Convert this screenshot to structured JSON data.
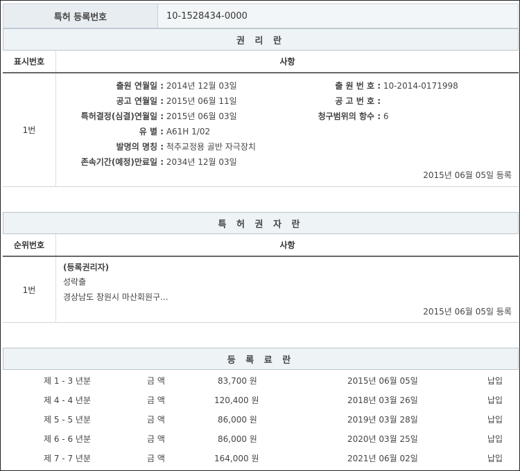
{
  "top": {
    "label": "특허 등록번호",
    "value": "10-1528434-0000"
  },
  "rights": {
    "title": "권 리 란",
    "col1": "표시번호",
    "col2": "사항",
    "row_no": "1번",
    "filing_date_label": "출원 연월일 :",
    "filing_date": "2014년 12월 03일",
    "filing_no_label": "출 원 번 호 :",
    "filing_no": "10-2014-0171998",
    "pub_date_label": "공고 연월일 :",
    "pub_date": "2015년 06월 11일",
    "pub_no_label": "공 고 번 호 :",
    "pub_no": "",
    "decision_label": "특허결정(심결)연월일 :",
    "decision_date": "2015년 06월 03일",
    "claims_label": "청구범위의 항수 :",
    "claims": "6",
    "class_label": "유 별 :",
    "class": "A61H 1/02",
    "invention_label": "발명의 명칭 :",
    "invention": "척추교정용 골반 자극장치",
    "expiry_label": "존속기간(예정)만료일 :",
    "expiry": "2034년 12월 03일",
    "registered": "2015년 06월 05일 등록"
  },
  "holders": {
    "title": "특 허 권 자 란",
    "col1": "순위번호",
    "col2": "사항",
    "row_no": "1번",
    "type": "(등록권리자)",
    "name": "성락출",
    "address": "경상남도 창원시 마산회원구...",
    "registered": "2015년 06월 05일 등록"
  },
  "fees": {
    "title": "등 록 료 란",
    "rows": [
      {
        "period": "제 1 - 3 년분",
        "label": "금 액",
        "amount": "83,700 원",
        "date": "2015년 06월 05일",
        "status": "납입"
      },
      {
        "period": "제 4 - 4 년분",
        "label": "금 액",
        "amount": "120,400 원",
        "date": "2018년 03월 26일",
        "status": "납입"
      },
      {
        "period": "제 5 - 5 년분",
        "label": "금 액",
        "amount": "86,000 원",
        "date": "2019년 03월 28일",
        "status": "납입"
      },
      {
        "period": "제 6 - 6 년분",
        "label": "금 액",
        "amount": "86,000 원",
        "date": "2020년 03월 25일",
        "status": "납입"
      },
      {
        "period": "제 7 - 7 년분",
        "label": "금 액",
        "amount": "164,000 원",
        "date": "2021년 06월 02일",
        "status": "납입"
      }
    ]
  }
}
